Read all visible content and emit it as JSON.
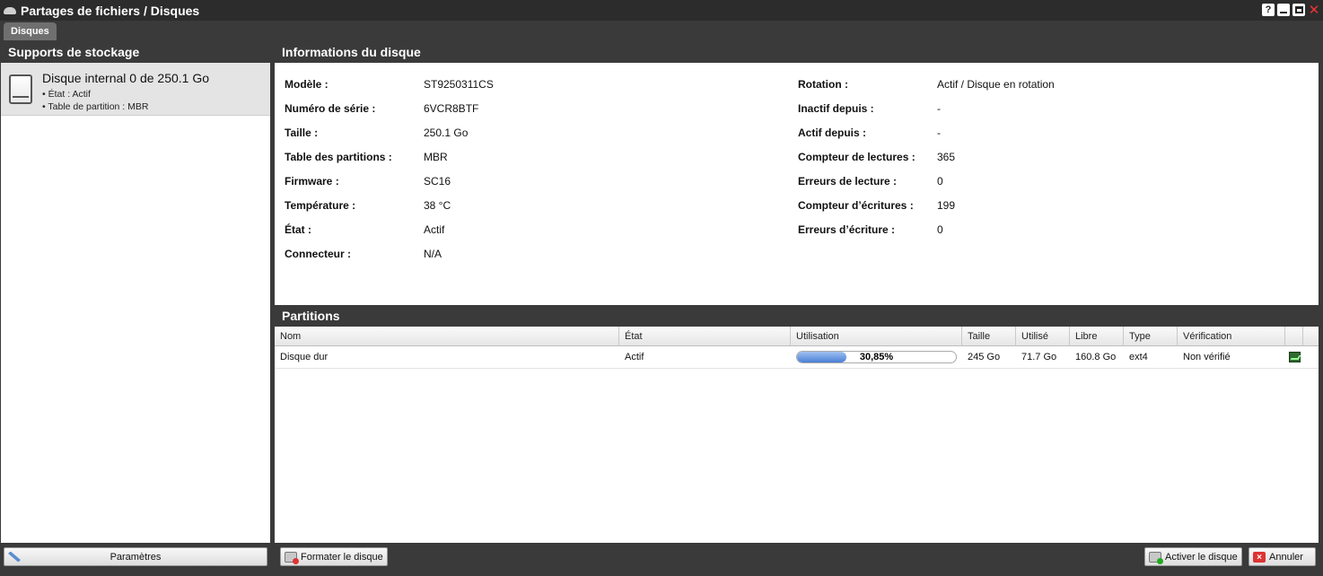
{
  "window": {
    "title": "Partages de fichiers / Disques",
    "help_label": "?",
    "close_label": "✕"
  },
  "tabs": [
    {
      "label": "Disques"
    }
  ],
  "left_panel": {
    "title": "Supports de stockage",
    "disk": {
      "name": "Disque internal 0 de 250.1 Go",
      "state": "• État : Actif",
      "partition_table": "• Table de partition : MBR"
    },
    "settings_button": "Paramètres"
  },
  "info_panel": {
    "title": "Informations du disque",
    "left": [
      {
        "label": "Modèle :",
        "value": "ST9250311CS"
      },
      {
        "label": "Numéro de série :",
        "value": "6VCR8BTF"
      },
      {
        "label": "Taille :",
        "value": "250.1 Go"
      },
      {
        "label": "Table des partitions :",
        "value": "MBR"
      },
      {
        "label": "Firmware :",
        "value": "SC16"
      },
      {
        "label": "Température :",
        "value": "38 °C"
      },
      {
        "label": "État :",
        "value": "Actif"
      },
      {
        "label": "Connecteur :",
        "value": "N/A"
      }
    ],
    "right": [
      {
        "label": "Rotation :",
        "value": "Actif / Disque en rotation"
      },
      {
        "label": "Inactif depuis :",
        "value": "-"
      },
      {
        "label": "Actif depuis :",
        "value": "-"
      },
      {
        "label": "Compteur de lectures :",
        "value": "365"
      },
      {
        "label": "Erreurs de lecture :",
        "value": "0"
      },
      {
        "label": "Compteur d’écritures :",
        "value": "199"
      },
      {
        "label": "Erreurs d’écriture :",
        "value": "0"
      }
    ]
  },
  "partitions": {
    "title": "Partitions",
    "columns": [
      "Nom",
      "État",
      "Utilisation",
      "Taille",
      "Utilisé",
      "Libre",
      "Type",
      "Vérification"
    ],
    "rows": [
      {
        "name": "Disque dur",
        "state": "Actif",
        "usage_label": "30,85%",
        "usage_fraction": 0.3085,
        "size": "245 Go",
        "used": "71.7 Go",
        "free": "160.8 Go",
        "type": "ext4",
        "verification": "Non vérifié",
        "action_icon": "check-disk-icon"
      }
    ]
  },
  "footer": {
    "format_button": "Formater le disque",
    "activate_button": "Activer le disque",
    "cancel_button": "Annuler"
  }
}
